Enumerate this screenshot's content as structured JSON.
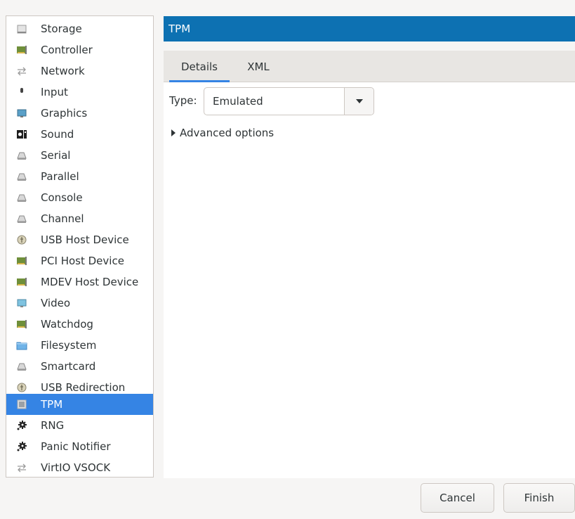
{
  "sidebar": {
    "items": [
      {
        "label": "Storage",
        "icon": "storage-icon"
      },
      {
        "label": "Controller",
        "icon": "controller-icon"
      },
      {
        "label": "Network",
        "icon": "network-icon"
      },
      {
        "label": "Input",
        "icon": "mouse-icon"
      },
      {
        "label": "Graphics",
        "icon": "monitor-icon"
      },
      {
        "label": "Sound",
        "icon": "sound-icon"
      },
      {
        "label": "Serial",
        "icon": "serial-icon"
      },
      {
        "label": "Parallel",
        "icon": "parallel-icon"
      },
      {
        "label": "Console",
        "icon": "console-icon"
      },
      {
        "label": "Channel",
        "icon": "channel-icon"
      },
      {
        "label": "USB Host Device",
        "icon": "usb-icon"
      },
      {
        "label": "PCI Host Device",
        "icon": "pci-card-icon"
      },
      {
        "label": "MDEV Host Device",
        "icon": "mdev-card-icon"
      },
      {
        "label": "Video",
        "icon": "video-icon"
      },
      {
        "label": "Watchdog",
        "icon": "watchdog-icon"
      },
      {
        "label": "Filesystem",
        "icon": "folder-icon"
      },
      {
        "label": "Smartcard",
        "icon": "smartcard-icon"
      },
      {
        "label": "USB Redirection",
        "icon": "usb-redirection-icon"
      },
      {
        "label": "TPM",
        "icon": "chip-icon",
        "selected": true
      },
      {
        "label": "RNG",
        "icon": "rng-gear-icon"
      },
      {
        "label": "Panic Notifier",
        "icon": "panic-gear-icon"
      },
      {
        "label": "VirtIO VSOCK",
        "icon": "vsock-icon"
      }
    ]
  },
  "header": {
    "title": "TPM"
  },
  "tabs": [
    {
      "label": "Details",
      "active": true
    },
    {
      "label": "XML",
      "active": false
    }
  ],
  "form": {
    "type_label": "Type:",
    "type_value": "Emulated",
    "advanced_label": "Advanced options"
  },
  "buttons": {
    "cancel": "Cancel",
    "finish": "Finish"
  },
  "colors": {
    "header_bg": "#0d71b2",
    "selection_bg": "#3584e4",
    "tab_underline": "#3584e4"
  }
}
